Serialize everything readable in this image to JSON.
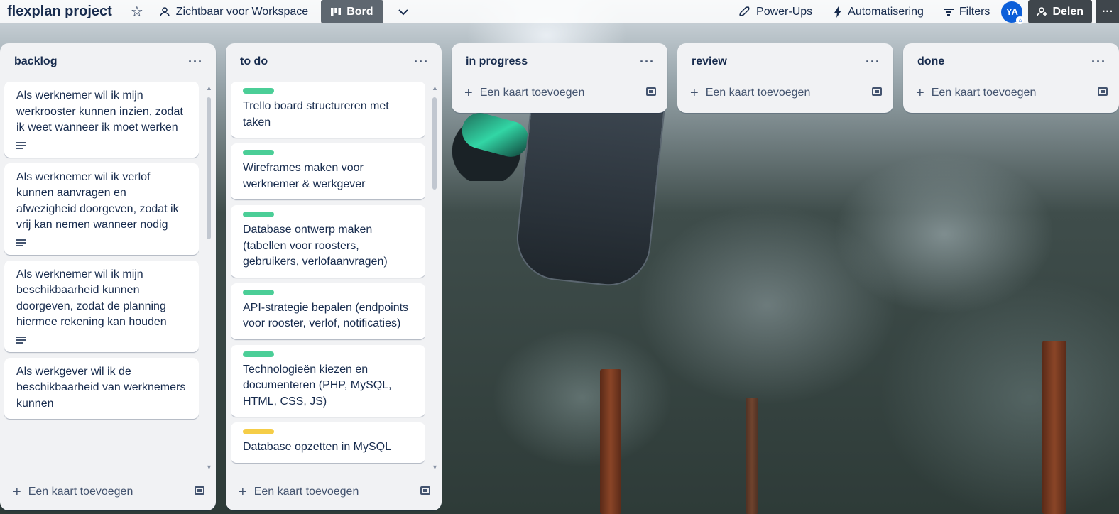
{
  "topbar": {
    "board_title": "flexplan project",
    "visibility_label": "Zichtbaar voor Workspace",
    "view_label": "Bord",
    "powerups_label": "Power-Ups",
    "automation_label": "Automatisering",
    "filters_label": "Filters",
    "avatar_initials": "YA",
    "share_label": "Delen"
  },
  "lists": [
    {
      "title": "backlog",
      "add_label": "Een kaart toevoegen",
      "cards": [
        {
          "text": "Als werknemer wil ik mijn werkrooster kunnen inzien, zodat ik weet wanneer ik moet werken",
          "has_description": true
        },
        {
          "text": "Als werknemer wil ik verlof kunnen aanvragen en afwezigheid doorgeven, zodat ik vrij kan nemen wanneer nodig",
          "has_description": true
        },
        {
          "text": "Als werknemer wil ik mijn beschikbaarheid kunnen doorgeven, zodat de planning hiermee rekening kan houden",
          "has_description": true
        },
        {
          "text": "Als werkgever wil ik de beschikbaarheid van werknemers kunnen",
          "has_description": false
        }
      ]
    },
    {
      "title": "to do",
      "add_label": "Een kaart toevoegen",
      "cards": [
        {
          "text": "Trello board structureren met taken",
          "label_color": "#4bce97"
        },
        {
          "text": "Wireframes maken voor werknemer & werkgever",
          "label_color": "#4bce97"
        },
        {
          "text": "Database ontwerp maken (tabellen voor roosters, gebruikers, verlofaanvragen)",
          "label_color": "#4bce97"
        },
        {
          "text": "API-strategie bepalen (endpoints voor rooster, verlof, notificaties)",
          "label_color": "#4bce97"
        },
        {
          "text": "Technologieën kiezen en documenteren (PHP, MySQL, HTML, CSS, JS)",
          "label_color": "#4bce97"
        },
        {
          "text": "Database opzetten in MySQL",
          "label_color": "#f5cd47"
        }
      ]
    },
    {
      "title": "in progress",
      "add_label": "Een kaart toevoegen",
      "cards": []
    },
    {
      "title": "review",
      "add_label": "Een kaart toevoegen",
      "cards": []
    },
    {
      "title": "done",
      "add_label": "Een kaart toevoegen",
      "cards": []
    }
  ],
  "colors": {
    "label_green": "#4bce97",
    "label_yellow": "#f5cd47",
    "avatar_blue": "#0c5fd9"
  }
}
